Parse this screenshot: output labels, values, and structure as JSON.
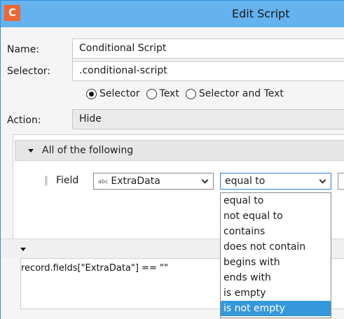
{
  "window": {
    "title": "Edit Script",
    "logo_letter": "C",
    "logo_color": "#ef6631",
    "titlebar_color": "#64b2ee"
  },
  "form": {
    "name_label": "Name:",
    "name_value": "Conditional Script",
    "selector_label": "Selector:",
    "selector_value": ".conditional-script",
    "match_options": [
      {
        "label": "Selector",
        "checked": true
      },
      {
        "label": "Text",
        "checked": false
      },
      {
        "label": "Selector and Text",
        "checked": false
      }
    ],
    "action_label": "Action:",
    "action_value": "Hide"
  },
  "conditions": {
    "group_label": "All of the following",
    "row": {
      "field_label": "Field",
      "field_type_icon": "abc",
      "field_value": "ExtraData",
      "operator_value": "equal to"
    },
    "operator_options": [
      "equal to",
      "not equal to",
      "contains",
      "does not contain",
      "begins with",
      "ends with",
      "is empty",
      "is not empty"
    ],
    "highlighted_option": "is not empty",
    "highlight_color": "#3598db"
  },
  "script": {
    "code": "record.fields[\"ExtraData\"] == \"\""
  }
}
